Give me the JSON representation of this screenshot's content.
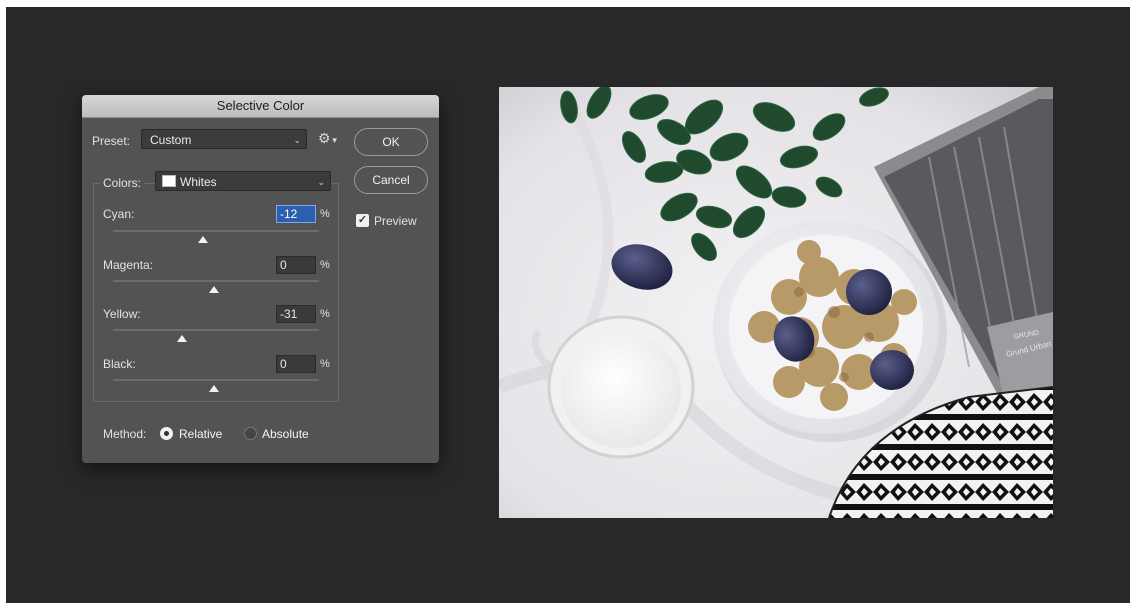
{
  "dialog": {
    "title": "Selective Color",
    "preset_label": "Preset:",
    "preset_value": "Custom",
    "ok_label": "OK",
    "cancel_label": "Cancel",
    "preview_label": "Preview",
    "preview_checked": true,
    "colors_label": "Colors:",
    "colors_value": "Whites",
    "sliders": [
      {
        "label": "Cyan:",
        "value": "-12",
        "unit": "%"
      },
      {
        "label": "Magenta:",
        "value": "0",
        "unit": "%"
      },
      {
        "label": "Yellow:",
        "value": "-31",
        "unit": "%"
      },
      {
        "label": "Black:",
        "value": "0",
        "unit": "%"
      }
    ],
    "method_label": "Method:",
    "method_options": [
      "Relative",
      "Absolute"
    ],
    "method_selected": "Relative"
  },
  "photo": {
    "book_text_1": "GRUND",
    "book_text_2": "Grund Urban"
  },
  "colors": {
    "workspace": "#282828",
    "dialog_bg": "#535353",
    "highlight": "#2b5faf"
  }
}
